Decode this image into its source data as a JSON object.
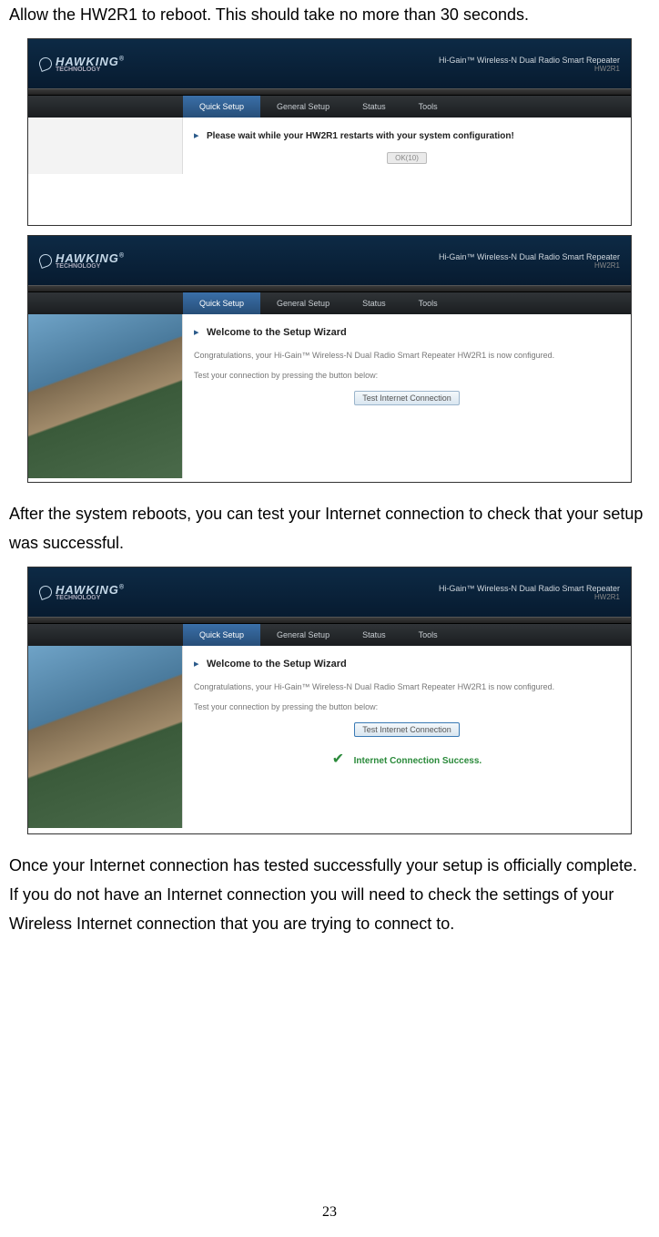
{
  "doc": {
    "para1": "Allow the HW2R1 to reboot.    This should take no more than 30 seconds.",
    "para2": "After the system reboots, you can test your Internet connection to check that your setup was successful.",
    "para3": "Once your Internet connection has tested successfully your setup is officially complete.    If you do not have an Internet connection you will need to check the settings of your Wireless Internet connection that you are trying to connect to.",
    "page_number": "23"
  },
  "ui": {
    "logo_text": "HAWKING",
    "logo_sub": "TECHNOLOGY",
    "header_title": "Hi-Gain™ Wireless-N Dual Radio Smart Repeater",
    "header_model": "HW2R1",
    "nav": {
      "quick": "Quick Setup",
      "general": "General Setup",
      "status": "Status",
      "tools": "Tools"
    },
    "s1": {
      "wait_text": "Please wait while your HW2R1 restarts with your system configuration!",
      "ok_button": "OK(10)"
    },
    "wizard": {
      "title": "Welcome to the Setup Wizard",
      "congrats": "Congratulations, your Hi-Gain™ Wireless-N Dual Radio Smart Repeater HW2R1 is now configured.",
      "test_prompt": "Test your connection by pressing the button below:",
      "test_button": "Test Internet Connection",
      "success": "Internet Connection Success."
    }
  }
}
